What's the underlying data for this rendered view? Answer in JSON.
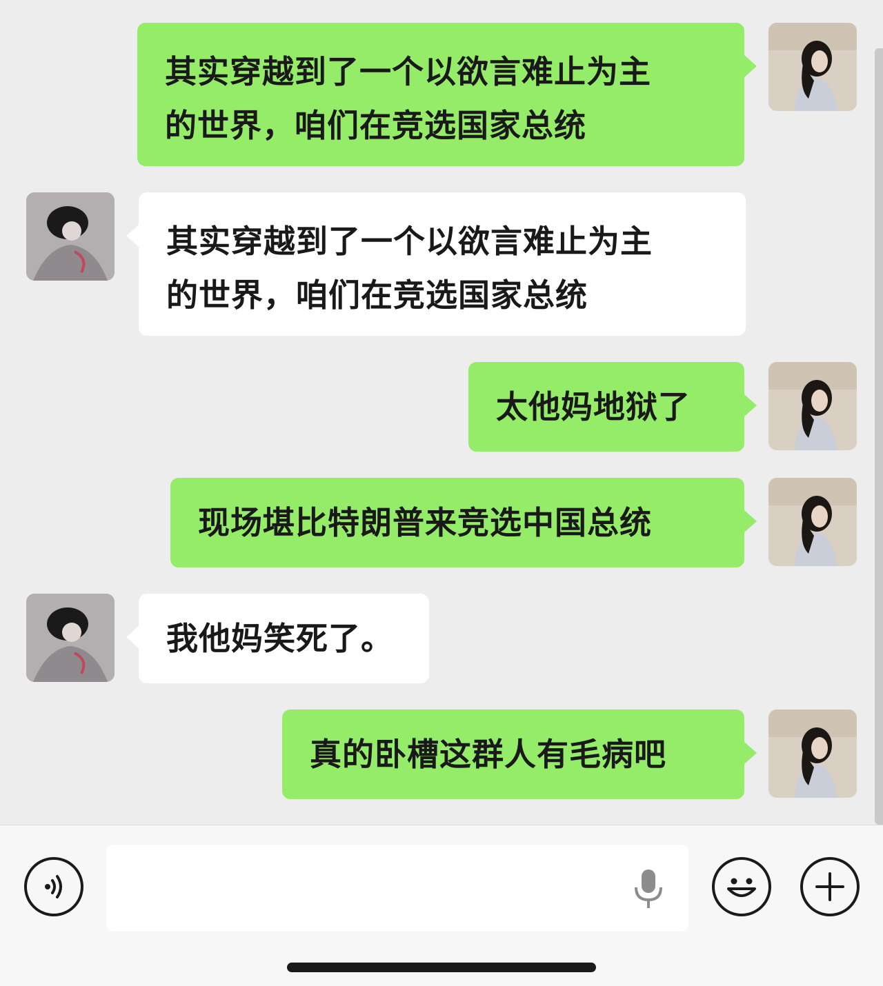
{
  "messages": [
    {
      "side": "right",
      "text": "其实穿越到了一个以欲言难止为主\n的世界，咱们在竞选国家总统"
    },
    {
      "side": "left",
      "text": "其实穿越到了一个以欲言难止为主\n的世界，咱们在竞选国家总统"
    },
    {
      "side": "right",
      "text": "太他妈地狱了"
    },
    {
      "side": "right",
      "text": "现场堪比特朗普来竞选中国总统"
    },
    {
      "side": "left",
      "text": "我他妈笑死了。"
    },
    {
      "side": "right",
      "text": "真的卧槽这群人有毛病吧"
    }
  ],
  "input": {
    "value": "",
    "placeholder": ""
  },
  "icons": {
    "voice": "voice-mode-icon",
    "mic": "mic-icon",
    "emoji": "emoji-icon",
    "plus": "plus-icon"
  },
  "colors": {
    "background": "#ededed",
    "bubble_self": "#95ec69",
    "bubble_other": "#ffffff",
    "text": "#191919"
  }
}
